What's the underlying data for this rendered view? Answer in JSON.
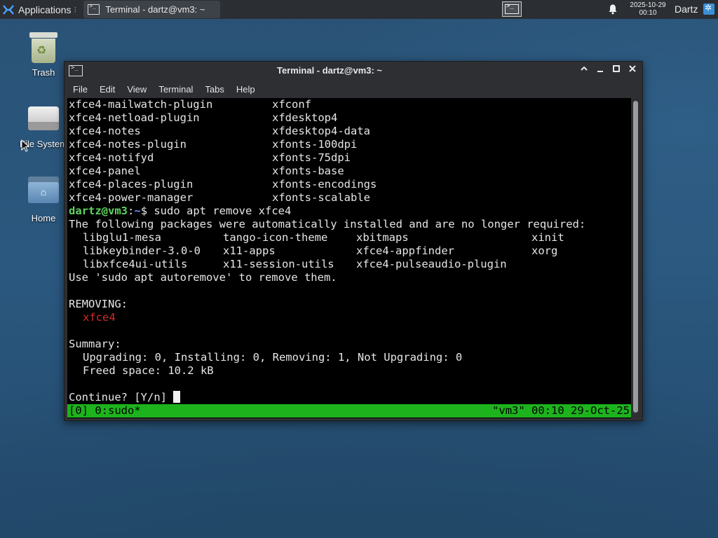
{
  "panel": {
    "applications_label": "Applications",
    "separator": "⁝",
    "task_title": "Terminal - dartz@vm3: ~",
    "clock_date": "2025-10-29",
    "clock_time": "00:10",
    "user": "Dartz"
  },
  "desktop": {
    "icons": [
      {
        "label": "Trash"
      },
      {
        "label": "File System"
      },
      {
        "label": "Home"
      }
    ]
  },
  "window": {
    "title": "Terminal - dartz@vm3: ~",
    "menu": [
      "File",
      "Edit",
      "View",
      "Terminal",
      "Tabs",
      "Help"
    ]
  },
  "terminal": {
    "two_col": [
      [
        "xfce4-mailwatch-plugin",
        "xfconf"
      ],
      [
        "xfce4-netload-plugin",
        "xfdesktop4"
      ],
      [
        "xfce4-notes",
        "xfdesktop4-data"
      ],
      [
        "xfce4-notes-plugin",
        "xfonts-100dpi"
      ],
      [
        "xfce4-notifyd",
        "xfonts-75dpi"
      ],
      [
        "xfce4-panel",
        "xfonts-base"
      ],
      [
        "xfce4-places-plugin",
        "xfonts-encodings"
      ],
      [
        "xfce4-power-manager",
        "xfonts-scalable"
      ]
    ],
    "prompt_user": "dartz@vm3",
    "prompt_sep": ":",
    "prompt_path": "~",
    "prompt_cmd": "$ sudo apt remove xfce4",
    "auto_msg": "The following packages were automatically installed and are no longer required:",
    "auto_rows": [
      [
        "libglu1-mesa",
        "tango-icon-theme",
        "xbitmaps",
        "xinit"
      ],
      [
        "libkeybinder-3.0-0",
        "x11-apps",
        "xfce4-appfinder",
        "xorg"
      ],
      [
        "libxfce4ui-utils",
        "x11-session-utils",
        "xfce4-pulseaudio-plugin",
        ""
      ]
    ],
    "autoremove_msg": "Use 'sudo apt autoremove' to remove them.",
    "removing_header": "REMOVING:",
    "removing_pkg": "xfce4",
    "summary_header": "Summary:",
    "summary_line": "Upgrading: 0, Installing: 0, Removing: 1, Not Upgrading: 0",
    "freed_line": "Freed space: 10.2 kB",
    "continue_prompt": "Continue? [Y/n] ",
    "status_left": "[0] 0:sudo*",
    "status_right": "\"vm3\" 00:10 29-Oct-25"
  }
}
